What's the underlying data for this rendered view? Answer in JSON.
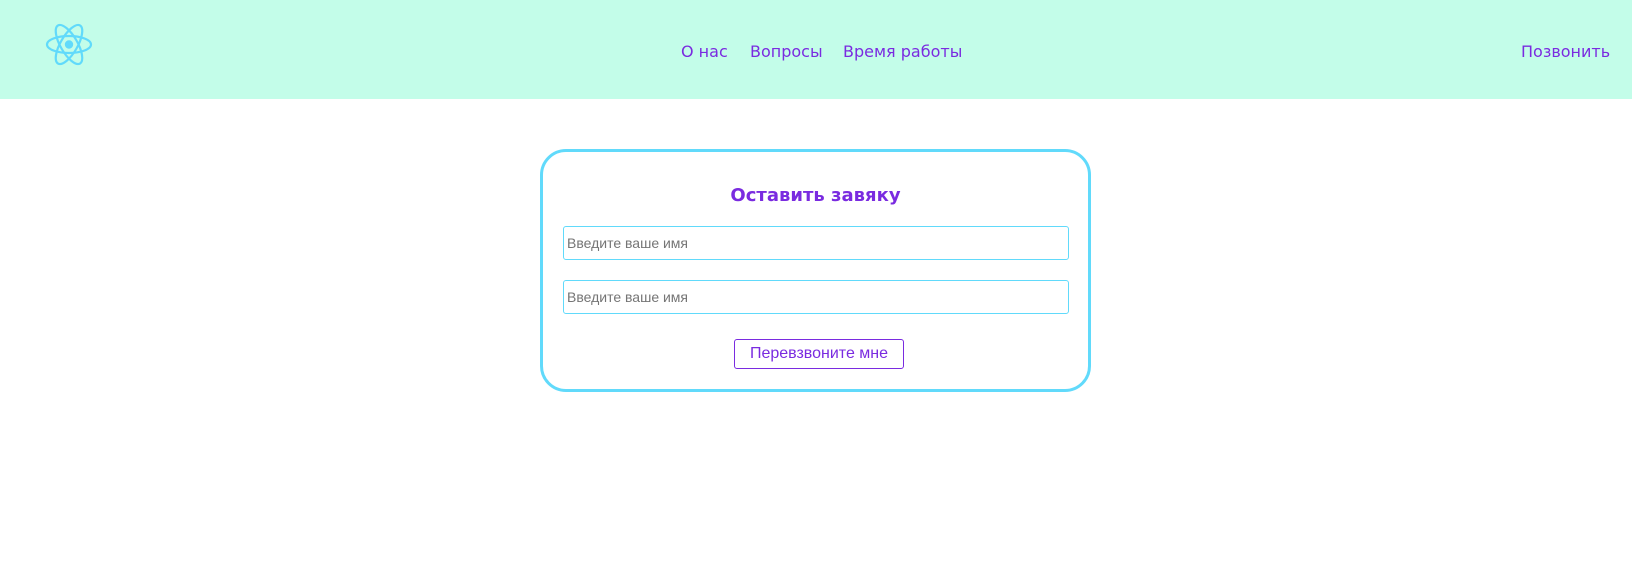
{
  "header": {
    "logo_icon": "react-atom-icon",
    "nav": {
      "about": "О нас",
      "questions": "Вопросы",
      "hours": "Время работы"
    },
    "call_link": "Позвонить"
  },
  "form": {
    "title": "Оставить завяку",
    "name_placeholder_1": "Введите ваше имя",
    "name_placeholder_2": "Введите ваше имя",
    "submit_label": "Перевзвоните мне"
  },
  "colors": {
    "header_bg": "#c3fde9",
    "accent": "#7a2be0",
    "border": "#61dafb"
  }
}
